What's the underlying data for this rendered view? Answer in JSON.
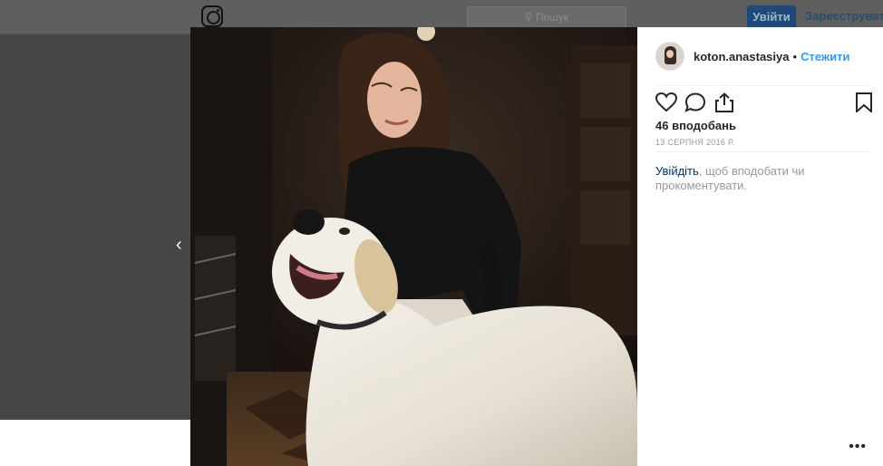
{
  "header": {
    "search_placeholder": "Пошук",
    "login_button": "Увійти",
    "signup_link": "Зареєструватися"
  },
  "post": {
    "username": "koton.anastasiya",
    "separator": "•",
    "follow_label": "Стежити",
    "likes": "46 вподобань",
    "date": "13 СЕРПНЯ 2016 Р.",
    "login_link": "Увійдіть",
    "login_prompt_rest": ", щоб вподобати чи прокоментувати.",
    "more_label": "•••"
  },
  "navigation": {
    "prev_arrow": "‹"
  },
  "colors": {
    "accent": "#3897f0",
    "link": "#003569",
    "overlay": "#464646"
  },
  "icons": [
    "instagram-logo-icon",
    "search-icon",
    "heart-icon",
    "comment-icon",
    "share-icon",
    "bookmark-icon",
    "more-icon",
    "chevron-left-icon"
  ]
}
